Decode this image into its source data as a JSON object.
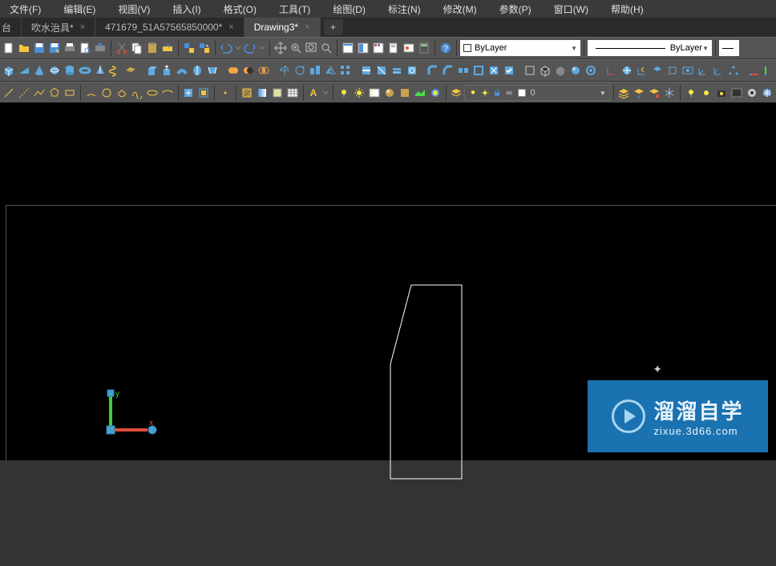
{
  "menu": [
    {
      "label": "文件(F)"
    },
    {
      "label": "编辑(E)"
    },
    {
      "label": "视图(V)"
    },
    {
      "label": "插入(I)"
    },
    {
      "label": "格式(O)"
    },
    {
      "label": "工具(T)"
    },
    {
      "label": "绘图(D)"
    },
    {
      "label": "标注(N)"
    },
    {
      "label": "修改(M)"
    },
    {
      "label": "参数(P)"
    },
    {
      "label": "窗口(W)"
    },
    {
      "label": "帮助(H)"
    }
  ],
  "tabs": [
    {
      "label": "台",
      "partial": true,
      "active": false
    },
    {
      "label": "吹水治具*",
      "active": false
    },
    {
      "label": "471679_51A57565850000*",
      "active": false
    },
    {
      "label": "Drawing3*",
      "active": true
    }
  ],
  "layer_dropdown": {
    "value": "0"
  },
  "color_dropdown": {
    "value": "ByLayer"
  },
  "linetype_dropdown": {
    "value": "ByLayer"
  },
  "watermark": {
    "main": "溜溜自学",
    "sub": "zixue.3d66.com"
  },
  "ucs": {
    "x_label": "x",
    "y_label": "y"
  },
  "icons": {
    "close": "×",
    "add": "+",
    "dropdown": "▼"
  }
}
